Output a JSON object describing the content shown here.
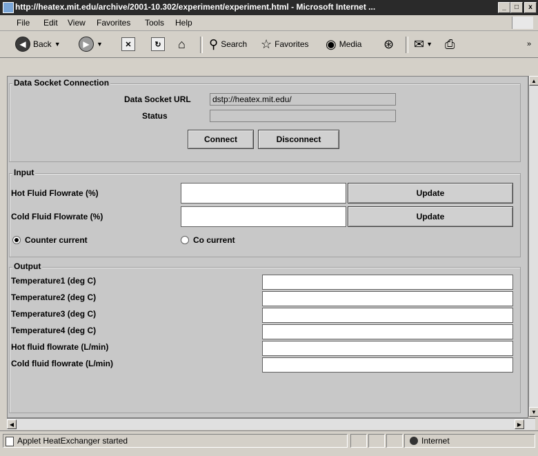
{
  "window": {
    "title": "http://heatex.mit.edu/archive/2001-10.302/experiment/experiment.html - Microsoft Internet ...",
    "controls": {
      "minimize": "_",
      "maximize": "□",
      "close": "x"
    }
  },
  "menu": [
    "File",
    "Edit",
    "View",
    "Favorites",
    "Tools",
    "Help"
  ],
  "toolbar": {
    "back_label": "Back",
    "search_label": "Search",
    "favorites_label": "Favorites",
    "media_label": "Media",
    "overflow": "»"
  },
  "datasocket": {
    "legend": "Data Socket Connection",
    "url_label": "Data Socket URL",
    "url_value": "dstp://heatex.mit.edu/",
    "status_label": "Status",
    "status_value": "",
    "connect_label": "Connect",
    "disconnect_label": "Disconnect"
  },
  "input": {
    "legend": "Input",
    "hot_label": "Hot Fluid Flowrate (%)",
    "hot_value": "",
    "cold_label": "Cold Fluid Flowrate (%)",
    "cold_value": "",
    "update_label": "Update",
    "radio_counter": "Counter current",
    "radio_co": "Co current",
    "selected_mode": "Counter current"
  },
  "output": {
    "legend": "Output",
    "rows": [
      {
        "label": "Temperature1 (deg C)",
        "value": ""
      },
      {
        "label": "Temperature2 (deg C)",
        "value": ""
      },
      {
        "label": "Temperature3 (deg C)",
        "value": ""
      },
      {
        "label": "Temperature4 (deg C)",
        "value": ""
      },
      {
        "label": "Hot fluid flowrate (L/min)",
        "value": ""
      },
      {
        "label": "Cold fluid flowrate (L/min)",
        "value": ""
      }
    ]
  },
  "status": {
    "text": "Applet HeatExchanger started",
    "zone": "Internet"
  }
}
